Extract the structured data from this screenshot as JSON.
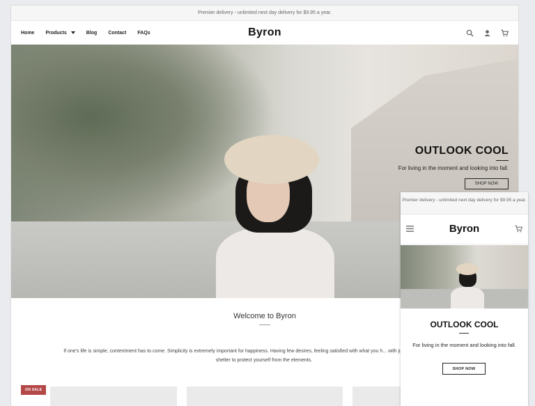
{
  "desktop": {
    "announcement": "Premier delivery - unlimited next day delivery for $9.95 a year.",
    "nav": [
      {
        "label": "Home"
      },
      {
        "label": "Products"
      },
      {
        "label": "Blog"
      },
      {
        "label": "Contact"
      },
      {
        "label": "FAQs"
      }
    ],
    "logo": "Byron",
    "icons": [
      "search-icon",
      "account-icon",
      "cart-icon"
    ],
    "hero": {
      "title": "OUTLOOK COOL",
      "subtitle": "For living in the moment and looking into fall.",
      "button": "SHOP NOW"
    },
    "welcome": {
      "title": "Welcome to Byron",
      "body": "If one's life is simple, contentment has to come. Simplicity is extremely important for happiness. Having few desires, feeling satisfied with what you h... with just enough food, clothing, and shelter to protect yourself from the elements."
    },
    "sale_badge": "ON SALE"
  },
  "mobile": {
    "announcement": "Premier delivery - unlimited next day delivery for $9.95 a year.",
    "logo": "Byron",
    "icons": [
      "menu-icon",
      "cart-icon"
    ],
    "hero_title": "OUTLOOK COOL",
    "hero_subtitle": "For living in the moment and looking into fall.",
    "button": "SHOP NOW"
  },
  "colors": {
    "sale_badge": "#b44848",
    "text_dark": "#111111",
    "announcement_bg": "#f6f6f6"
  }
}
